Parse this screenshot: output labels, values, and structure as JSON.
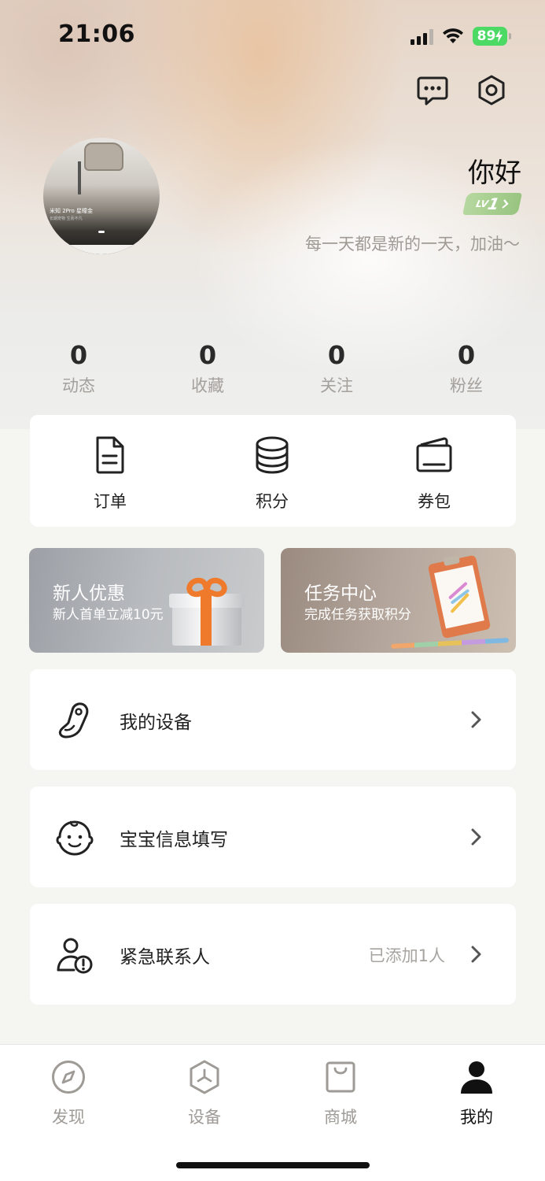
{
  "status_bar": {
    "time": "21:06",
    "battery": "89"
  },
  "header_icons": [
    "message-icon",
    "settings-icon"
  ],
  "profile": {
    "greeting": "你好",
    "level": {
      "prefix": "LV",
      "number": "1",
      "arrow": ">"
    },
    "motto": "每一天都是新的一天，加油～",
    "avatar_caption": "米知 2Pro 星瞳金",
    "avatar_subcaption": "长期宠物 生而不凡"
  },
  "stats": [
    {
      "value": "0",
      "label": "动态"
    },
    {
      "value": "0",
      "label": "收藏"
    },
    {
      "value": "0",
      "label": "关注"
    },
    {
      "value": "0",
      "label": "粉丝"
    }
  ],
  "quick_actions": [
    {
      "label": "订单",
      "icon": "order-document-icon"
    },
    {
      "label": "积分",
      "icon": "coins-stack-icon"
    },
    {
      "label": "券包",
      "icon": "wallet-icon"
    }
  ],
  "promos": [
    {
      "title": "新人优惠",
      "subtitle": "新人首单立减10元"
    },
    {
      "title": "任务中心",
      "subtitle": "完成任务获取积分"
    }
  ],
  "menu": [
    {
      "label": "我的设备",
      "value": "",
      "icon": "car-seat-icon"
    },
    {
      "label": "宝宝信息填写",
      "value": "",
      "icon": "baby-face-icon"
    },
    {
      "label": "紧急联系人",
      "value": "已添加1人",
      "icon": "emergency-contact-icon"
    }
  ],
  "tabs": [
    {
      "label": "发现",
      "icon": "compass-icon",
      "active": false
    },
    {
      "label": "设备",
      "icon": "device-hexagon-icon",
      "active": false
    },
    {
      "label": "商城",
      "icon": "shopping-bag-icon",
      "active": false
    },
    {
      "label": "我的",
      "icon": "person-icon",
      "active": true
    }
  ],
  "colors": {
    "accent_green": "#4cd964",
    "level_badge": "#a8cf90",
    "muted_text": "#a4a09c",
    "promo_orange": "#f07a2c"
  }
}
